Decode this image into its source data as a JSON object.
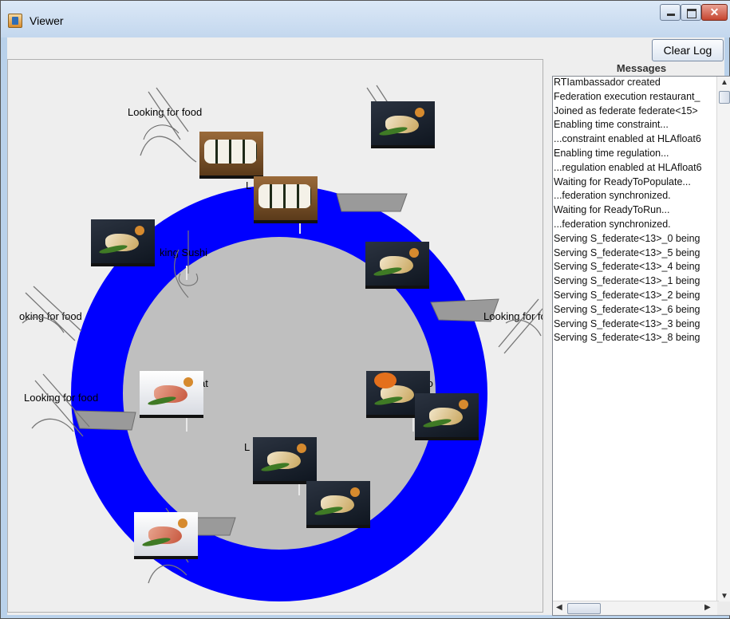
{
  "window": {
    "title": "Viewer"
  },
  "toolbar": {
    "clear_log_label": "Clear Log"
  },
  "messages": {
    "header": "Messages",
    "lines": [
      "RTIambassador created",
      "Federation execution restaurant_",
      "Joined as federate federate<15>",
      "Enabling time constraint...",
      "...constraint enabled at HLAfloat6",
      "Enabling time regulation...",
      "...regulation enabled at HLAfloat6",
      "Waiting for ReadyToPopulate...",
      "...federation synchronized.",
      "Waiting for ReadyToRun...",
      "...federation synchronized.",
      "Serving S_federate<13>_0 being",
      "Serving S_federate<13>_5 being",
      "Serving S_federate<13>_4 being",
      "Serving S_federate<13>_1 being",
      "Serving S_federate<13>_2 being",
      "Serving S_federate<13>_6 being",
      "Serving S_federate<13>_3 being",
      "Serving S_federate<13>_8 being"
    ]
  },
  "scene": {
    "labels": {
      "looking_top": "Looking for food",
      "looking_left": "oking for food",
      "looking_right": "Looking for fo",
      "looking_lower_left": "Looking for food",
      "eating_sushi": "king Sushi",
      "partial_top": "L",
      "partial_top_suffix": "at",
      "partial_left": "at",
      "partial_right": "L",
      "partial_right_suffix": "fo",
      "partial_bottom": "L",
      "partial_bottom_suffix": "at"
    },
    "colors": {
      "conveyor": "#0000ff",
      "table": "#bfbfbf"
    }
  }
}
